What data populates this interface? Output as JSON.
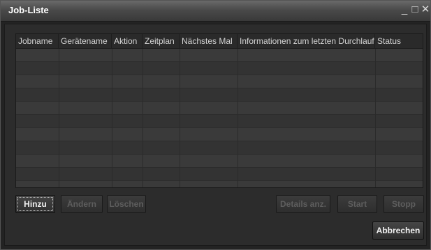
{
  "window": {
    "title": "Job-Liste",
    "controls": {
      "minimize": "_",
      "maximize": "□",
      "close": "✕"
    }
  },
  "table": {
    "columns": [
      "Jobname",
      "Gerätename",
      "Aktion",
      "Zeitplan",
      "Nächstes Mal",
      "Informationen zum letzten Durchlauf",
      "Status"
    ],
    "rows": []
  },
  "buttons": {
    "add": "Hinzu",
    "edit": "Ändern",
    "delete": "Löschen",
    "details": "Details anz.",
    "start": "Start",
    "stop": "Stopp",
    "cancel": "Abbrechen"
  },
  "colors": {
    "title_text": "#ffffff",
    "enabled_text": "#f0f0f0",
    "disabled_text": "#5e5e5e"
  }
}
